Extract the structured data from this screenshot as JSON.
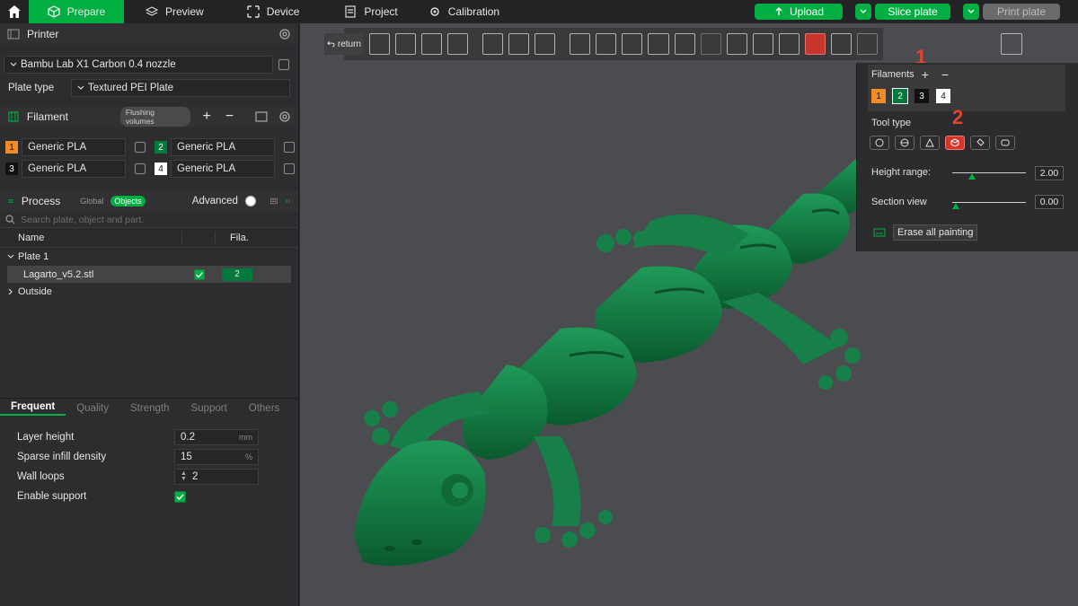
{
  "topbar": {
    "tabs": [
      "Prepare",
      "Preview",
      "Device",
      "Project",
      "Calibration"
    ],
    "upload": "Upload",
    "slice": "Slice plate",
    "print": "Print plate"
  },
  "printer": {
    "title": "Printer",
    "model": "Bambu Lab X1 Carbon 0.4 nozzle",
    "plate_label": "Plate type",
    "plate": "Textured PEI Plate"
  },
  "filament": {
    "title": "Filament",
    "flushing": "Flushing volumes",
    "items": [
      {
        "num": "1",
        "name": "Generic PLA",
        "color": "#f28c28"
      },
      {
        "num": "2",
        "name": "Generic PLA",
        "color": "#00793c"
      },
      {
        "num": "3",
        "name": "Generic PLA",
        "color": "#111111"
      },
      {
        "num": "4",
        "name": "Generic PLA",
        "color": "#ffffff"
      }
    ]
  },
  "process": {
    "title": "Process",
    "global": "Global",
    "objects": "Objects",
    "advanced": "Advanced",
    "search_placeholder": "Search plate, object and part.",
    "col_name": "Name",
    "col_fila": "Fila.",
    "plate": "Plate 1",
    "object": "Lagarto_v5.2.stl",
    "object_fila": "2",
    "outside": "Outside"
  },
  "settings": {
    "tabs": [
      "Frequent",
      "Quality",
      "Strength",
      "Support",
      "Others"
    ],
    "layer_height_label": "Layer height",
    "layer_height": "0.2",
    "layer_height_unit": "mm",
    "infill_label": "Sparse infill density",
    "infill": "15",
    "infill_unit": "%",
    "wall_label": "Wall loops",
    "wall": "2",
    "support_label": "Enable support"
  },
  "viewport": {
    "return": "return"
  },
  "paint_panel": {
    "filaments_label": "Filaments",
    "filaments": [
      {
        "num": "1",
        "color": "#f28c28"
      },
      {
        "num": "2",
        "color": "#00793c"
      },
      {
        "num": "3",
        "color": "#111111"
      },
      {
        "num": "4",
        "color": "#ffffff"
      }
    ],
    "tool_type_label": "Tool type",
    "height_range_label": "Height range:",
    "height_range": "2.00",
    "section_view_label": "Section view",
    "section_view": "0.00",
    "erase": "Erase all painting",
    "annot1": "1",
    "annot2": "2"
  }
}
